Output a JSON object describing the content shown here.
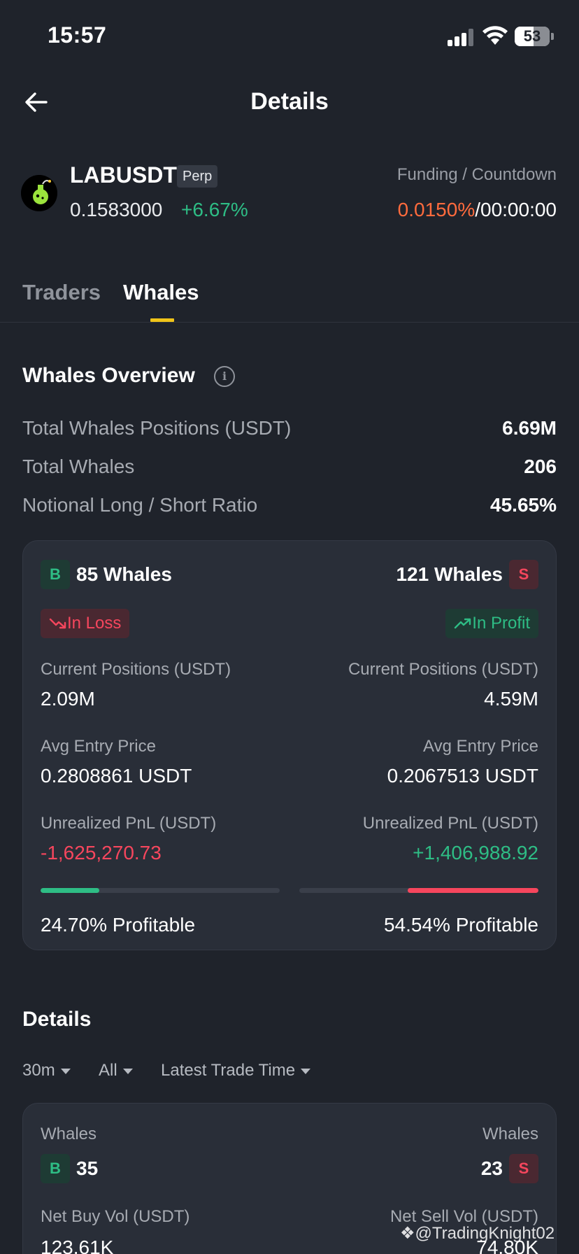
{
  "status_bar": {
    "time": "15:57",
    "battery": "53"
  },
  "header": {
    "title": "Details"
  },
  "ticker": {
    "pair": "LABUSDT",
    "tag": "Perp",
    "price": "0.1583000",
    "change": "+6.67%",
    "funding_label": "Funding / Countdown",
    "funding_rate": "0.0150%",
    "funding_sep": "/",
    "countdown": "00:00:00"
  },
  "tabs": [
    {
      "label": "Traders",
      "active": false
    },
    {
      "label": "Whales",
      "active": true
    }
  ],
  "overview": {
    "title": "Whales Overview",
    "rows": [
      {
        "label": "Total Whales Positions (USDT)",
        "value": "6.69M"
      },
      {
        "label": "Total Whales",
        "value": "206"
      },
      {
        "label": "Notional Long / Short Ratio",
        "value": "45.65%"
      }
    ]
  },
  "long_short_card": {
    "long": {
      "badge": "B",
      "whales": "85 Whales",
      "status": "In Loss",
      "positions_label": "Current Positions (USDT)",
      "positions": "2.09M",
      "avg_entry_label": "Avg Entry Price",
      "avg_entry": "0.2808861 USDT",
      "pnl_label": "Unrealized PnL (USDT)",
      "pnl": "-1,625,270.73",
      "profitable_fraction": 0.247,
      "profitable": "24.70% Profitable"
    },
    "short": {
      "badge": "S",
      "whales": "121 Whales",
      "status": "In Profit",
      "positions_label": "Current Positions (USDT)",
      "positions": "4.59M",
      "avg_entry_label": "Avg Entry Price",
      "avg_entry": "0.2067513 USDT",
      "pnl_label": "Unrealized PnL (USDT)",
      "pnl": "+1,406,988.92",
      "profitable_fraction": 0.5454,
      "profitable": "54.54% Profitable"
    }
  },
  "details": {
    "title": "Details",
    "filters": [
      "30m",
      "All",
      "Latest Trade Time"
    ],
    "card": {
      "buy_whales_label": "Whales",
      "buy_badge": "B",
      "buy_whales": "35",
      "sell_whales_label": "Whales",
      "sell_badge": "S",
      "sell_whales": "23",
      "net_buy_label": "Net Buy Vol (USDT)",
      "net_buy": "123.61K",
      "net_sell_label": "Net Sell Vol (USDT)",
      "net_sell": "74.80K"
    }
  },
  "watermark": "@TradingKnight02",
  "colors": {
    "green": "#2ebd85",
    "red": "#f6465d",
    "orange": "#ff6b3d",
    "accent": "#f0c419",
    "background": "#1f232b"
  }
}
